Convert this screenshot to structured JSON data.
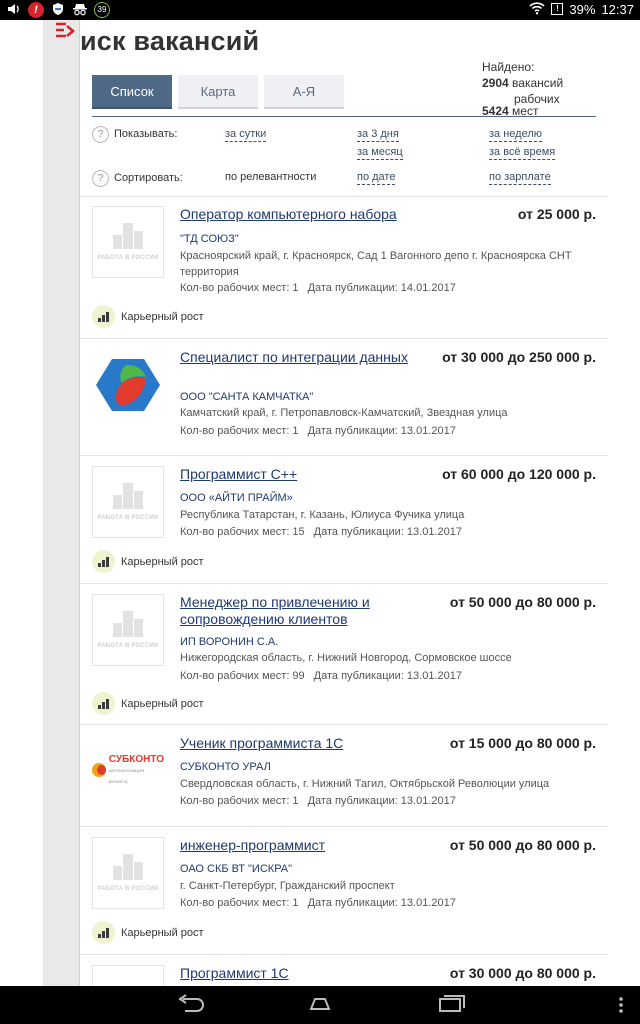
{
  "status_bar": {
    "battery_pct": "39%",
    "battery_mark": "!",
    "notif_badge": "39",
    "app_icon_letter": "!",
    "time": "12:37"
  },
  "page": {
    "title": "иск вакансий",
    "tabs": [
      {
        "label": "Список",
        "active": true
      },
      {
        "label": "Карта",
        "active": false
      },
      {
        "label": "А-Я",
        "active": false
      }
    ],
    "found": {
      "label": "Найдено:",
      "vacancies_count": "2904",
      "vacancies_word": "вакансий",
      "places_prefix_word": "рабочих",
      "places_count": "5424",
      "places_word": "мест"
    },
    "filters": {
      "help_symbol": "?",
      "show_label": "Показывать:",
      "show_options": [
        "за сутки",
        "за 3 дня",
        "за неделю",
        "за месяц",
        "за всё время"
      ],
      "sort_label": "Сортировать:",
      "sort_options": [
        "по релевантности",
        "по дате",
        "по зарплате"
      ]
    }
  },
  "jobs": [
    {
      "title": "Оператор компьютерного набора",
      "salary": "от 25 000 р.",
      "company": "\"ТД СОЮЗ\"",
      "address": "Красноярский край, г. Красноярск, Сад 1 Вагонного депо г. Красноярска СНТ территория",
      "places": "Кол-во рабочих мест: 1",
      "date": "Дата публикации: 14.01.2017",
      "badge": "Карьерный рост",
      "logo": "placeholder"
    },
    {
      "title": "Специалист по интеграции данных",
      "salary": "от 30 000 до 250 000 р.",
      "company": "ООО \"САНТА КАМЧАТКА\"",
      "address": "Камчатский край, г. Петропавловск-Камчатский, Звездная улица",
      "places": "Кол-во рабочих мест: 1",
      "date": "Дата публикации: 13.01.2017",
      "logo": "santa-kamchatka"
    },
    {
      "title": "Программист С++",
      "salary": "от 60 000 до 120 000 р.",
      "company": "ООО «АЙТИ ПРАЙМ»",
      "address": "Республика Татарстан, г. Казань, Юлиуса Фучика улица",
      "places": "Кол-во рабочих мест: 15",
      "date": "Дата публикации: 13.01.2017",
      "badge": "Карьерный рост",
      "logo": "placeholder"
    },
    {
      "title": "Менеджер по привлечению и сопровождению клиентов",
      "salary": "от 50 000 до 80 000 р.",
      "company": "ИП ВОРОНИН С.А.",
      "address": "Нижегородская область, г. Нижний Новгород, Сормовское шоссе",
      "places": "Кол-во рабочих мест: 99",
      "date": "Дата публикации: 13.01.2017",
      "badge": "Карьерный рост",
      "logo": "placeholder"
    },
    {
      "title": "Ученик программиста 1С",
      "salary": "от 15 000 до 80 000 р.",
      "company": "СУБКОНТО УРАЛ",
      "address": "Свердловская область, г. Нижний Тагил, Октябрьской Революции улица",
      "places": "Кол-во рабочих мест: 1",
      "date": "Дата публикации: 13.01.2017",
      "logo": "subkonto"
    },
    {
      "title": "инженер-программист",
      "salary": "от 50 000 до 80 000 р.",
      "company": "ОАО СКБ ВТ \"ИСКРА\"",
      "address": "г. Санкт-Петербург, Гражданский проспект",
      "places": "Кол-во рабочих мест: 1",
      "date": "Дата публикации: 13.01.2017",
      "badge": "Карьерный рост",
      "logo": "placeholder"
    },
    {
      "title": "Программист 1С",
      "salary": "от 30 000 до 80 000 р."
    }
  ],
  "logos": {
    "placeholder_caption": "РАБОТА В РОССИИ",
    "subkonto_text": "СУБКОНТО",
    "subkonto_subtext": "АВТОМАТИЗАЦИЯ БИЗНЕСА"
  },
  "colors": {
    "accent": "#4e6886",
    "link": "#1e3a6e",
    "brand_red": "#d9232b"
  }
}
